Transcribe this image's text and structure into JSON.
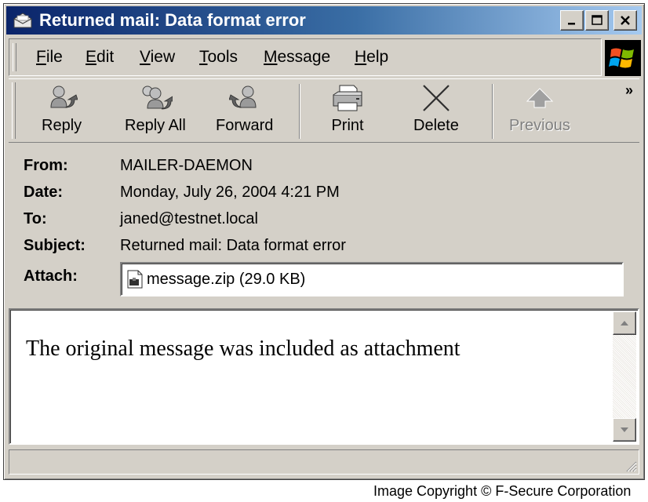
{
  "window": {
    "title": "Returned mail: Data format error"
  },
  "menu": {
    "items": [
      {
        "label": "File",
        "mnemonic": "F",
        "rest": "ile"
      },
      {
        "label": "Edit",
        "mnemonic": "E",
        "rest": "dit"
      },
      {
        "label": "View",
        "mnemonic": "V",
        "rest": "iew"
      },
      {
        "label": "Tools",
        "mnemonic": "T",
        "rest": "ools"
      },
      {
        "label": "Message",
        "mnemonic": "M",
        "rest": "essage"
      },
      {
        "label": "Help",
        "mnemonic": "H",
        "rest": "elp"
      }
    ]
  },
  "toolbar": {
    "reply": "Reply",
    "reply_all": "Reply All",
    "forward": "Forward",
    "print": "Print",
    "delete": "Delete",
    "previous": "Previous",
    "overflow": "»"
  },
  "header": {
    "from_label": "From:",
    "from_value": "MAILER-DAEMON",
    "date_label": "Date:",
    "date_value": "Monday, July 26, 2004 4:21 PM",
    "to_label": "To:",
    "to_value": "janed@testnet.local",
    "subject_label": "Subject:",
    "subject_value": "Returned mail: Data format error",
    "attach_label": "Attach:",
    "attachment": "message.zip (29.0 KB)"
  },
  "message": {
    "body": "The original message was included as attachment"
  },
  "footer": {
    "copyright": "Image Copyright © F-Secure Corporation"
  },
  "colors": {
    "titlebar_start": "#0a246a",
    "titlebar_end": "#a6caf0",
    "chrome": "#d4d0c8"
  }
}
